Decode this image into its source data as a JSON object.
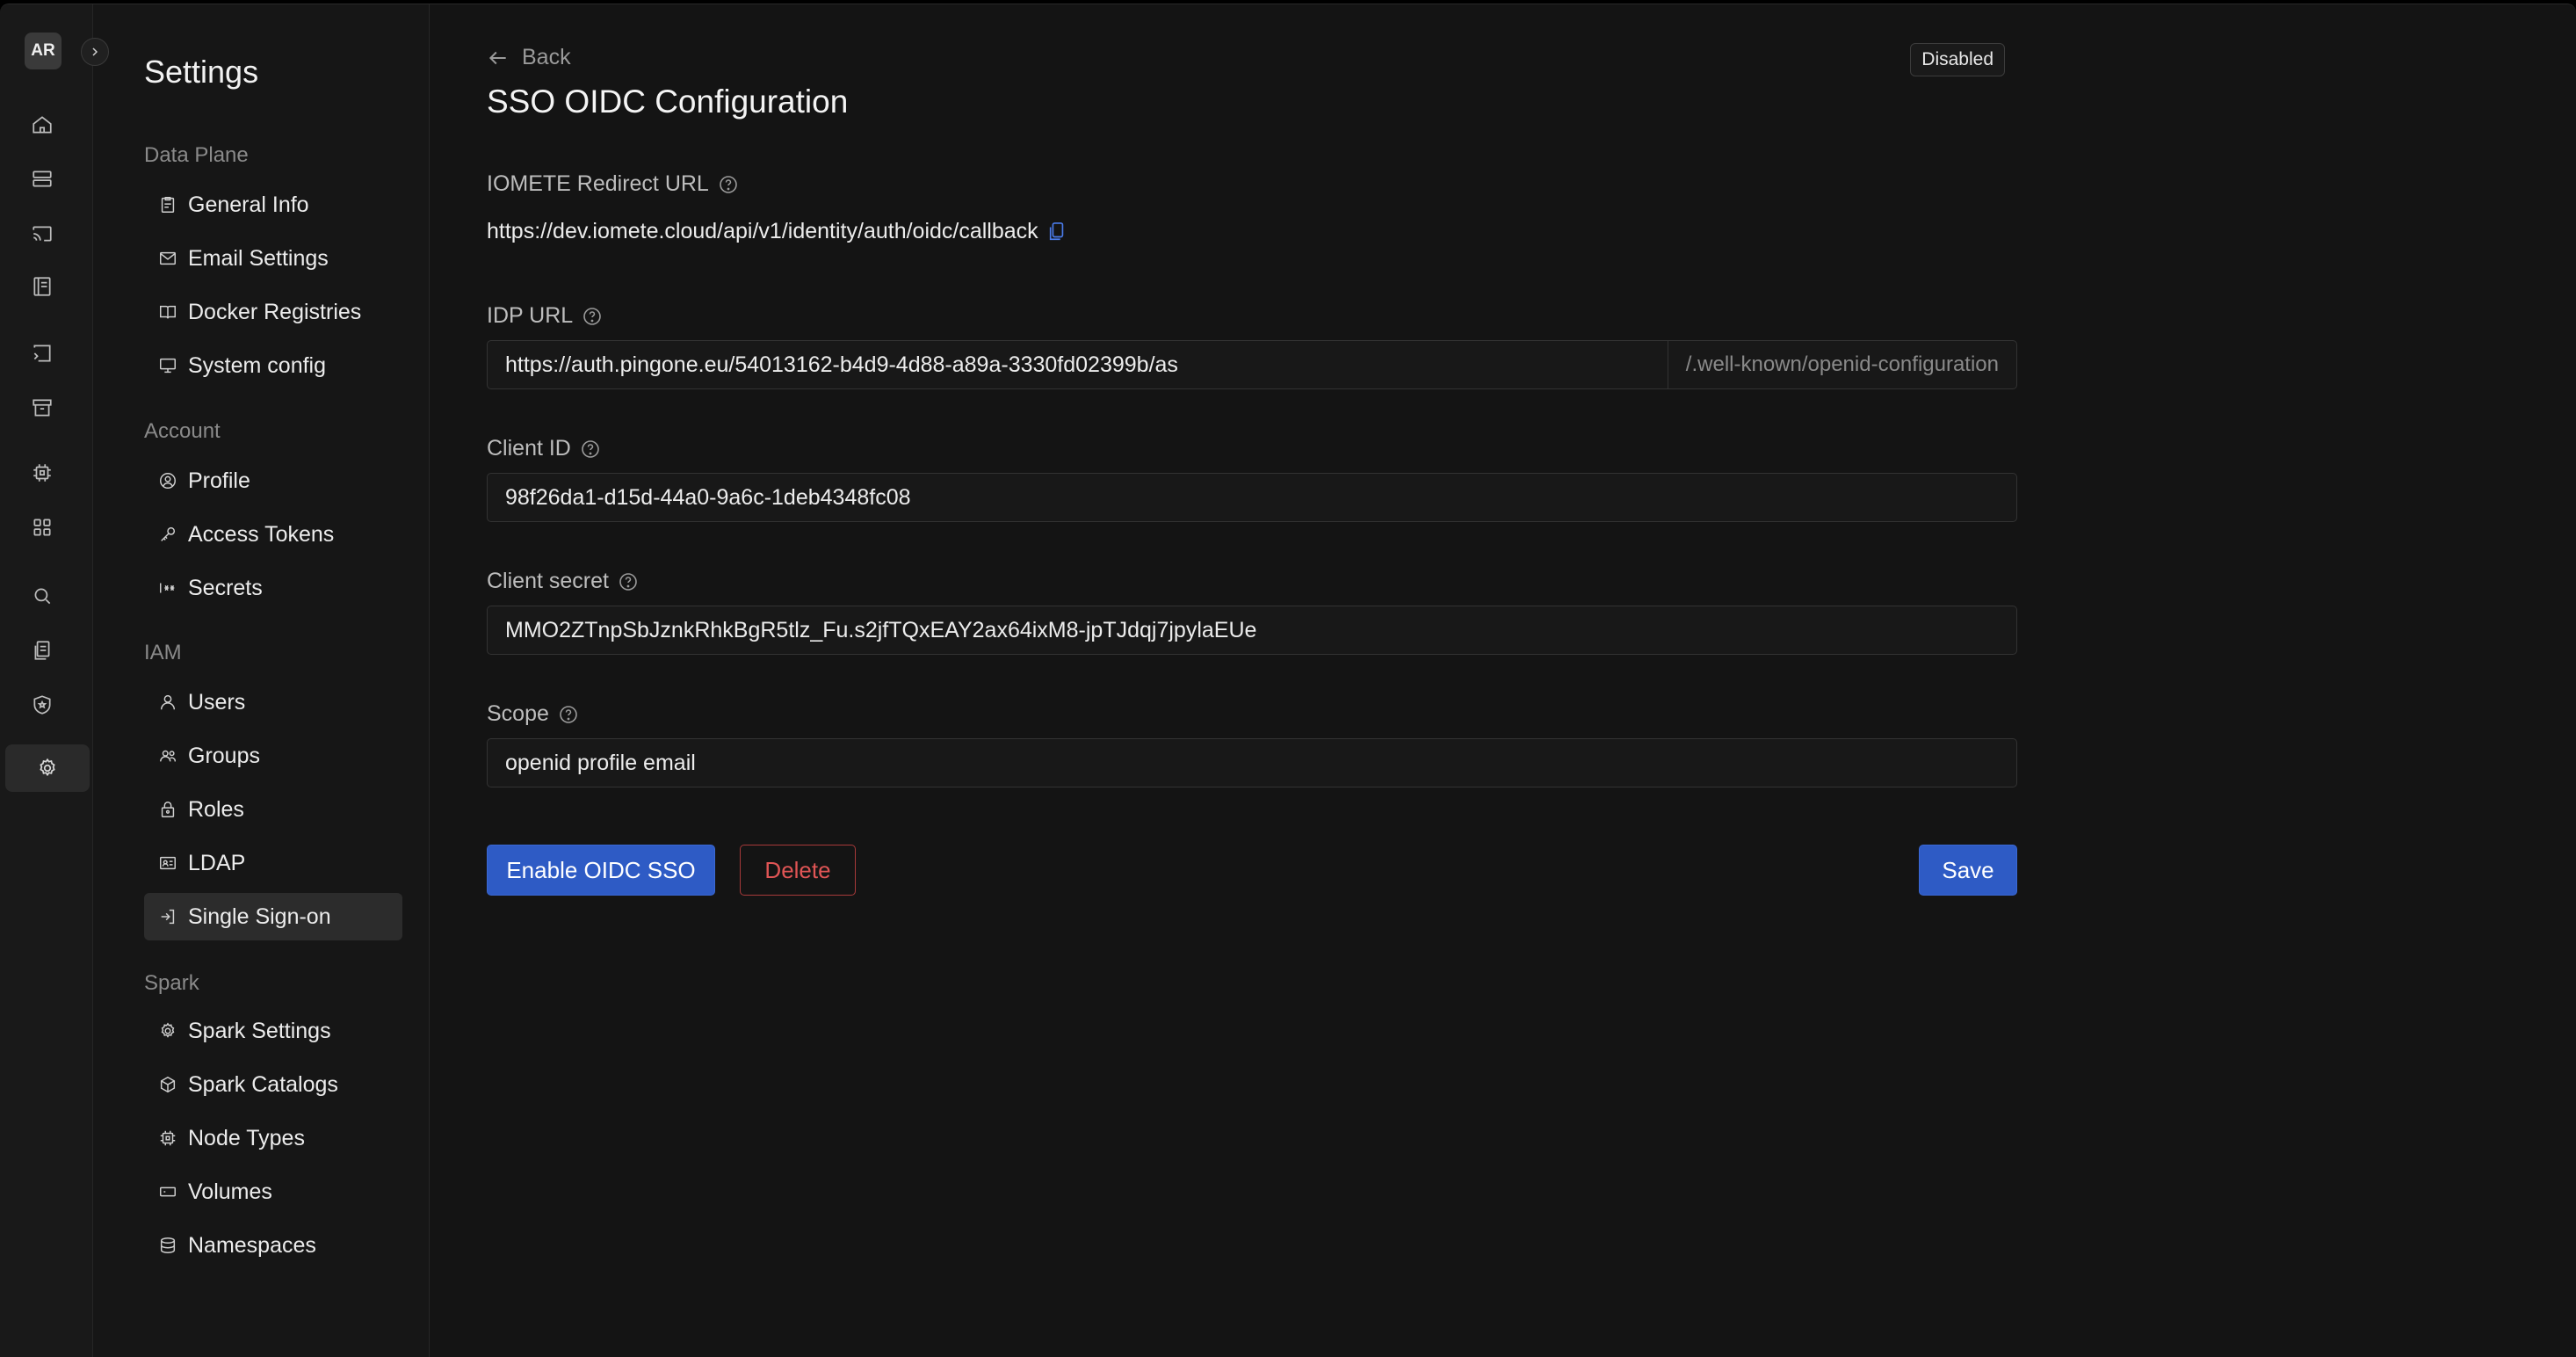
{
  "user": {
    "initials": "AR"
  },
  "rail": {
    "items": [
      "home-icon",
      "database-icon",
      "cast-icon",
      "notebook-icon",
      "sql-editor-icon",
      "archive-icon",
      "chip-icon",
      "apps-icon",
      "search-icon",
      "documents-icon",
      "shield-icon",
      "settings-icon"
    ],
    "active": "settings-icon"
  },
  "sidebar": {
    "title": "Settings",
    "groups": [
      {
        "label": "Data Plane",
        "items": [
          "General Info",
          "Email Settings",
          "Docker Registries",
          "System config"
        ]
      },
      {
        "label": "Account",
        "items": [
          "Profile",
          "Access Tokens",
          "Secrets"
        ]
      },
      {
        "label": "IAM",
        "items": [
          "Users",
          "Groups",
          "Roles",
          "LDAP",
          "Single Sign-on"
        ]
      },
      {
        "label": "Spark",
        "items": [
          "Spark Settings",
          "Spark Catalogs",
          "Node Types",
          "Volumes",
          "Namespaces"
        ]
      }
    ],
    "active_item": "Single Sign-on"
  },
  "main": {
    "back_label": "Back",
    "title": "SSO OIDC Configuration",
    "status": "Disabled",
    "redirect": {
      "label": "IOMETE Redirect URL",
      "value": "https://dev.iomete.cloud/api/v1/identity/auth/oidc/callback"
    },
    "idp_url": {
      "label": "IDP URL",
      "value": "https://auth.pingone.eu/54013162-b4d9-4d88-a89a-3330fd02399b/as",
      "suffix": "/.well-known/openid-configuration"
    },
    "client_id": {
      "label": "Client ID",
      "value": "98f26da1-d15d-44a0-9a6c-1deb4348fc08"
    },
    "client_secret": {
      "label": "Client secret",
      "value": "MMO2ZTnpSbJznkRhkBgR5tlz_Fu.s2jfTQxEAY2ax64ixM8-jpTJdqj7jpylaEUe"
    },
    "scope": {
      "label": "Scope",
      "value": "openid profile email"
    },
    "buttons": {
      "enable": "Enable OIDC SSO",
      "delete": "Delete",
      "save": "Save"
    }
  },
  "colors": {
    "accent": "#2e5bc5",
    "danger": "#e05555",
    "background": "#141414"
  }
}
